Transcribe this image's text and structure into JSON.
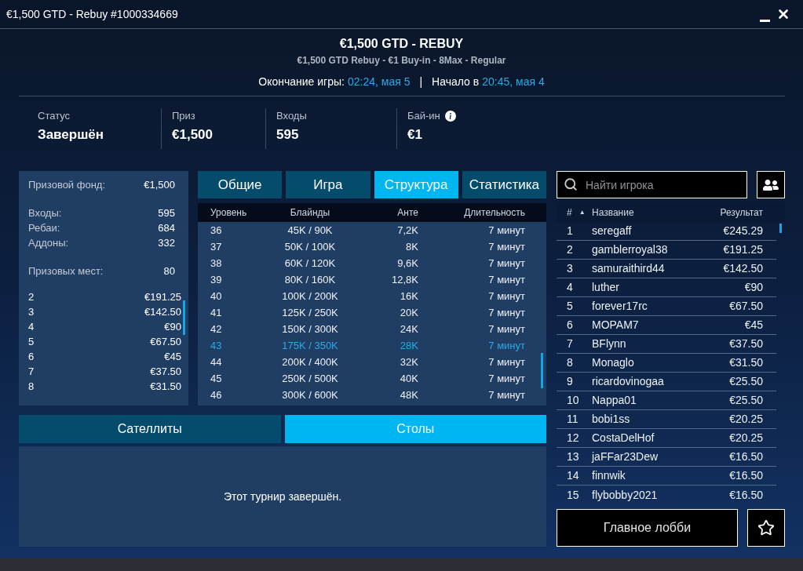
{
  "window": {
    "title": "€1,500 GTD - Rebuy #1000334669"
  },
  "header": {
    "title": "€1,500 GTD - REBUY",
    "subtitle": "€1,500 GTD Rebuy - €1 Buy-in - 8Max - Regular",
    "end_label": "Окончание игры:",
    "end_time": "02:24, мая 5",
    "separator": "|",
    "start_label": "Начало в",
    "start_time": "20:45, мая 4"
  },
  "stats": [
    {
      "label": "Статус",
      "value": "Завершён",
      "has_info": false
    },
    {
      "label": "Приз",
      "value": "€1,500",
      "has_info": false
    },
    {
      "label": "Входы",
      "value": "595",
      "has_info": false
    },
    {
      "label": "Бай-ин",
      "value": "€1",
      "has_info": true
    }
  ],
  "summary": {
    "groups": [
      [
        {
          "label": "Призовой фонд:",
          "value": "€1,500"
        }
      ],
      [
        {
          "label": "Входы:",
          "value": "595"
        },
        {
          "label": "Ребаи:",
          "value": "684"
        },
        {
          "label": "Аддоны:",
          "value": "332"
        }
      ],
      [
        {
          "label": "Призовых мест:",
          "value": "80"
        }
      ]
    ],
    "payouts": [
      {
        "place": "2",
        "prize": "€191.25"
      },
      {
        "place": "3",
        "prize": "€142.50"
      },
      {
        "place": "4",
        "prize": "€90"
      },
      {
        "place": "5",
        "prize": "€67.50"
      },
      {
        "place": "6",
        "prize": "€45"
      },
      {
        "place": "7",
        "prize": "€37.50"
      },
      {
        "place": "8",
        "prize": "€31.50"
      }
    ]
  },
  "tabs": [
    {
      "label": "Общие",
      "selected": false
    },
    {
      "label": "Игра",
      "selected": false
    },
    {
      "label": "Структура",
      "selected": true
    },
    {
      "label": "Статистика",
      "selected": false
    }
  ],
  "structure": {
    "columns": [
      "Уровень",
      "Блайнды",
      "Анте",
      "Длительность"
    ],
    "rows": [
      {
        "cells": [
          "36",
          "45K / 90K",
          "7,2K",
          "7 минут"
        ],
        "selected": false
      },
      {
        "cells": [
          "37",
          "50K / 100K",
          "8K",
          "7 минут"
        ],
        "selected": false
      },
      {
        "cells": [
          "38",
          "60K / 120K",
          "9,6K",
          "7 минут"
        ],
        "selected": false
      },
      {
        "cells": [
          "39",
          "80K / 160K",
          "12,8K",
          "7 минут"
        ],
        "selected": false
      },
      {
        "cells": [
          "40",
          "100K / 200K",
          "16K",
          "7 минут"
        ],
        "selected": false
      },
      {
        "cells": [
          "41",
          "125K / 250K",
          "20K",
          "7 минут"
        ],
        "selected": false
      },
      {
        "cells": [
          "42",
          "150K / 300K",
          "24K",
          "7 минут"
        ],
        "selected": false
      },
      {
        "cells": [
          "43",
          "175K / 350K",
          "28K",
          "7 минут"
        ],
        "selected": true
      },
      {
        "cells": [
          "44",
          "200K / 400K",
          "32K",
          "7 минут"
        ],
        "selected": false
      },
      {
        "cells": [
          "45",
          "250K / 500K",
          "40K",
          "7 минут"
        ],
        "selected": false
      },
      {
        "cells": [
          "46",
          "300K / 600K",
          "48K",
          "7 минут"
        ],
        "selected": false
      }
    ]
  },
  "bottom_tabs": [
    {
      "label": "Сателлиты",
      "selected": false
    },
    {
      "label": "Столы",
      "selected": true
    }
  ],
  "tables_panel": {
    "message": "Этот турнир завершён."
  },
  "players": {
    "search": {
      "placeholder": "Найти игрока"
    },
    "columns": {
      "rank": "#",
      "sort_indicator": "▲",
      "name": "Название",
      "result": "Результат"
    },
    "rows": [
      {
        "rank": "1",
        "name": "seregaff",
        "result": "€245.29"
      },
      {
        "rank": "2",
        "name": "gamblerroyal38",
        "result": "€191.25"
      },
      {
        "rank": "3",
        "name": "samuraithird44",
        "result": "€142.50"
      },
      {
        "rank": "4",
        "name": "luther",
        "result": "€90"
      },
      {
        "rank": "5",
        "name": "forever17rc",
        "result": "€67.50"
      },
      {
        "rank": "6",
        "name": "MOPAM7",
        "result": "€45"
      },
      {
        "rank": "7",
        "name": "BFlynn",
        "result": "€37.50"
      },
      {
        "rank": "8",
        "name": "Monaglo",
        "result": "€31.50"
      },
      {
        "rank": "9",
        "name": "ricardovinogaa",
        "result": "€25.50"
      },
      {
        "rank": "10",
        "name": "Nappa01",
        "result": "€25.50"
      },
      {
        "rank": "11",
        "name": "bobi1ss",
        "result": "€20.25"
      },
      {
        "rank": "12",
        "name": "CostaDelHof",
        "result": "€20.25"
      },
      {
        "rank": "13",
        "name": "jaFFar23Dew",
        "result": "€16.50"
      },
      {
        "rank": "14",
        "name": "finnwik",
        "result": "€16.50"
      },
      {
        "rank": "15",
        "name": "flybobby2021",
        "result": "€16.50"
      }
    ]
  },
  "footer": {
    "lobby_button": "Главное лобби"
  }
}
